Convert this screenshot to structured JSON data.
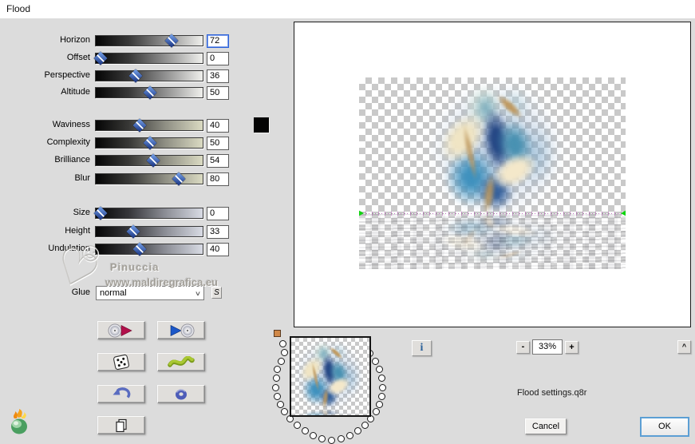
{
  "title": "Flood",
  "sliders": [
    {
      "label": "Horizon",
      "value": 72,
      "group": 0,
      "focused": true
    },
    {
      "label": "Offset",
      "value": 0,
      "group": 0
    },
    {
      "label": "Perspective",
      "value": 36,
      "group": 0
    },
    {
      "label": "Altitude",
      "value": 50,
      "group": 0
    },
    {
      "label": "Waviness",
      "value": 40,
      "group": 1
    },
    {
      "label": "Complexity",
      "value": 50,
      "group": 1
    },
    {
      "label": "Brilliance",
      "value": 54,
      "group": 1
    },
    {
      "label": "Blur",
      "value": 80,
      "group": 1
    },
    {
      "label": "Size",
      "value": 0,
      "group": 2
    },
    {
      "label": "Height",
      "value": 33,
      "group": 2
    },
    {
      "label": "Undulation",
      "value": 40,
      "group": 2
    }
  ],
  "glue": {
    "label": "Glue",
    "value": "normal",
    "s_button": "S"
  },
  "color_swatch": "#000000",
  "watermark": {
    "heart": "♡",
    "smiley": "☺",
    "name": "Pinuccia",
    "url": "www.maldiregrafica.eu"
  },
  "icon_buttons": [
    {
      "name": "load-settings-cd-play"
    },
    {
      "name": "save-settings-play-cd"
    },
    {
      "name": "randomize-dice"
    },
    {
      "name": "wave-preset-squiggle"
    },
    {
      "name": "undo-arrow"
    },
    {
      "name": "ring-donut"
    },
    {
      "name": "copy-page"
    }
  ],
  "info_button": "i",
  "zoom": {
    "minus": "-",
    "value": "33%",
    "plus": "+"
  },
  "scroll_up": "^",
  "settings_file": "Flood settings.q8r",
  "buttons": {
    "cancel": "Cancel",
    "ok": "OK"
  }
}
